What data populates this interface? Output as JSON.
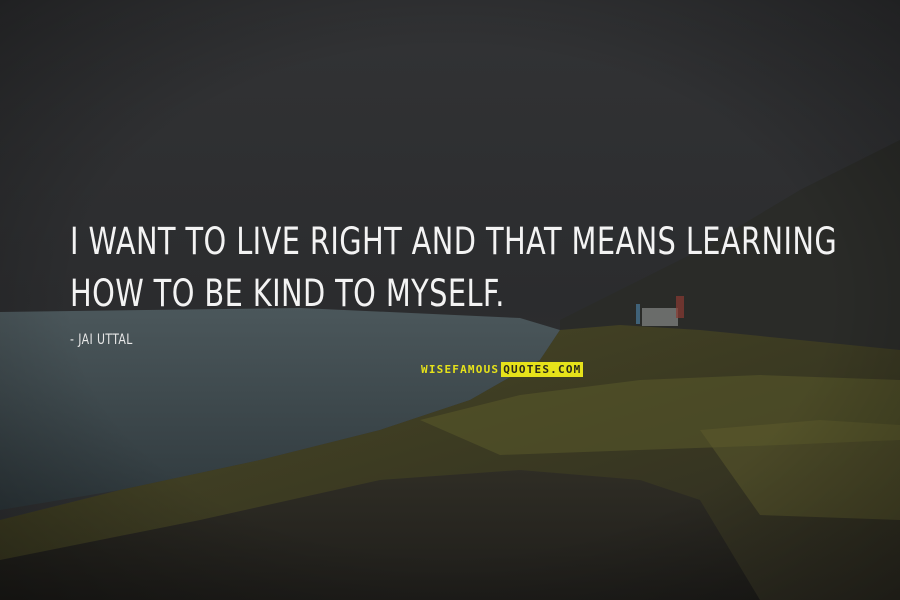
{
  "quote": {
    "text": "I want to live right and that means learning how to be kind to myself.",
    "author": "- Jai Uttal"
  },
  "watermark": {
    "left": "WISEFAMOUS",
    "right": "QUOTES.COM"
  },
  "colors": {
    "text": "#f3f3f3",
    "watermark_accent": "#e6e21a",
    "sky": "#2c2d2f",
    "lake": "#3f4a4f",
    "grass": "#5b5a2a"
  }
}
